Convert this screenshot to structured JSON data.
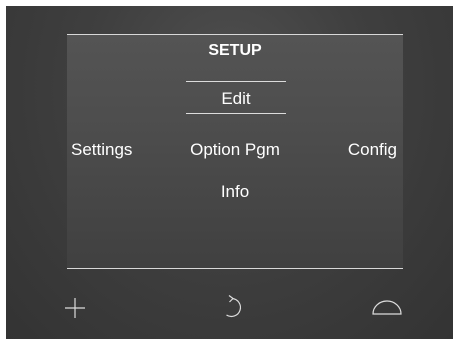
{
  "menu": {
    "title": "SETUP",
    "selected": "Edit",
    "items": {
      "settings": "Settings",
      "option_pgm": "Option Pgm",
      "config": "Config",
      "info": "Info"
    }
  },
  "softkeys": {
    "left_icon": "plus-icon",
    "center_icon": "rotate-back-icon",
    "right_icon": "dome-icon"
  },
  "colors": {
    "panel": "#3f3f3f",
    "screen": "#4d4d4d",
    "text": "#ffffff",
    "divider": "#d8d8d8"
  }
}
